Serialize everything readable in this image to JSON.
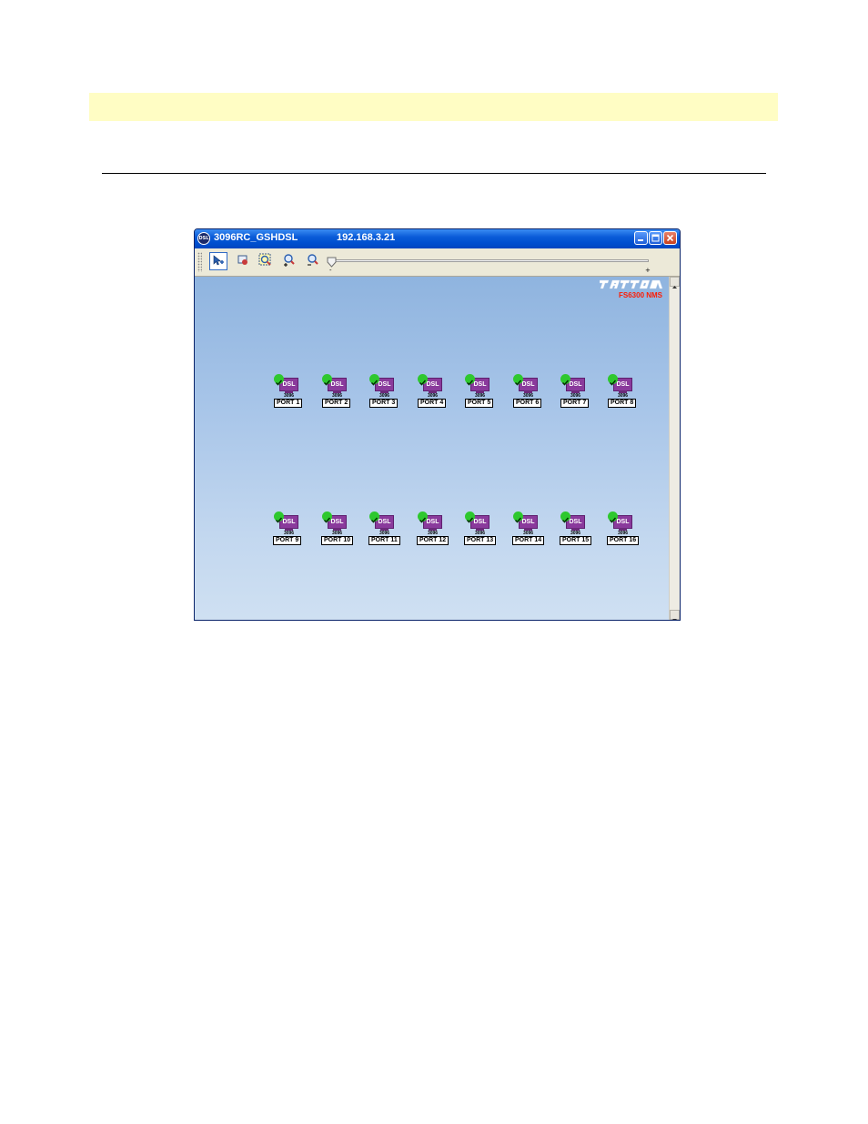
{
  "window": {
    "app_icon_text": "DSL",
    "title": "3096RC_GSHDSL",
    "ip": "192.168.3.21",
    "buttons": {
      "minimize": "minimize",
      "maximize": "maximize",
      "close": "close"
    }
  },
  "toolbar": {
    "tools": [
      {
        "icon": "select-pointer-icon",
        "active": true
      },
      {
        "icon": "fit-window-icon"
      },
      {
        "icon": "zoom-area-icon"
      },
      {
        "icon": "zoom-in-icon"
      },
      {
        "icon": "zoom-out-icon"
      }
    ],
    "zoom_slider": {
      "min_label": "-",
      "max_label": "+",
      "value": 0
    }
  },
  "brand": {
    "logo": "patton-logo",
    "subtitle": "FS6300 NMS",
    "subtitle_color": "#ff1a00"
  },
  "ports": {
    "chip_text": "DSL",
    "model": "3096",
    "status": "ok",
    "status_color": "#2ec82e",
    "chip_color": "#8a3a9c",
    "items": [
      {
        "label": "PORT 1"
      },
      {
        "label": "PORT 2"
      },
      {
        "label": "PORT 3"
      },
      {
        "label": "PORT 4"
      },
      {
        "label": "PORT 5"
      },
      {
        "label": "PORT 6"
      },
      {
        "label": "PORT 7"
      },
      {
        "label": "PORT 8"
      },
      {
        "label": "PORT 9"
      },
      {
        "label": "PORT 10"
      },
      {
        "label": "PORT 11"
      },
      {
        "label": "PORT 12"
      },
      {
        "label": "PORT 13"
      },
      {
        "label": "PORT 14"
      },
      {
        "label": "PORT 15"
      },
      {
        "label": "PORT 16"
      }
    ]
  },
  "colors": {
    "titlebar": "#0a5bd8",
    "page_highlight": "#fffdc4"
  }
}
